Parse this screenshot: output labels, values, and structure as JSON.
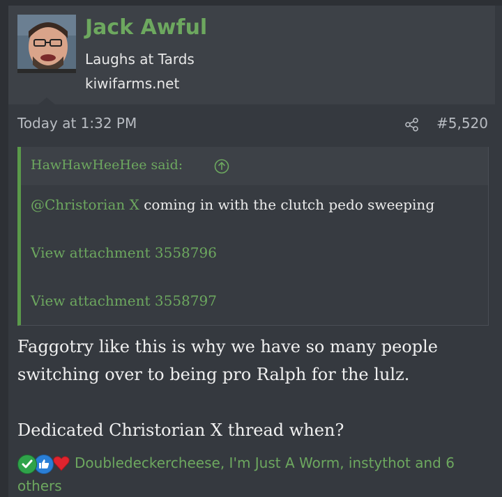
{
  "user": {
    "name": "Jack Awful",
    "title": "Laughs at Tards",
    "site": "kiwifarms.net"
  },
  "meta": {
    "timestamp": "Today at 1:32 PM",
    "post_number": "#5,520"
  },
  "quote": {
    "author": "HawHawHeeHee said:",
    "mention": "@Christorian X",
    "text": "coming in with the clutch pedo sweeping",
    "attachments": [
      "View attachment 3558796",
      "View attachment 3558797"
    ]
  },
  "message": {
    "line1": "Faggotry like this is why we have so many people",
    "line2": "switching over to being pro Ralph for the lulz.",
    "line3": "Dedicated Christorian X thread when?"
  },
  "reactions": {
    "icons": [
      "check-reaction",
      "like-reaction",
      "heart-reaction"
    ],
    "names": "Doubledeckercheese, I'm Just A Worm, instythot and 6",
    "others": "others"
  },
  "colors": {
    "accent": "#6da85f",
    "background": "#35393f",
    "user_bar": "#3d4147"
  }
}
